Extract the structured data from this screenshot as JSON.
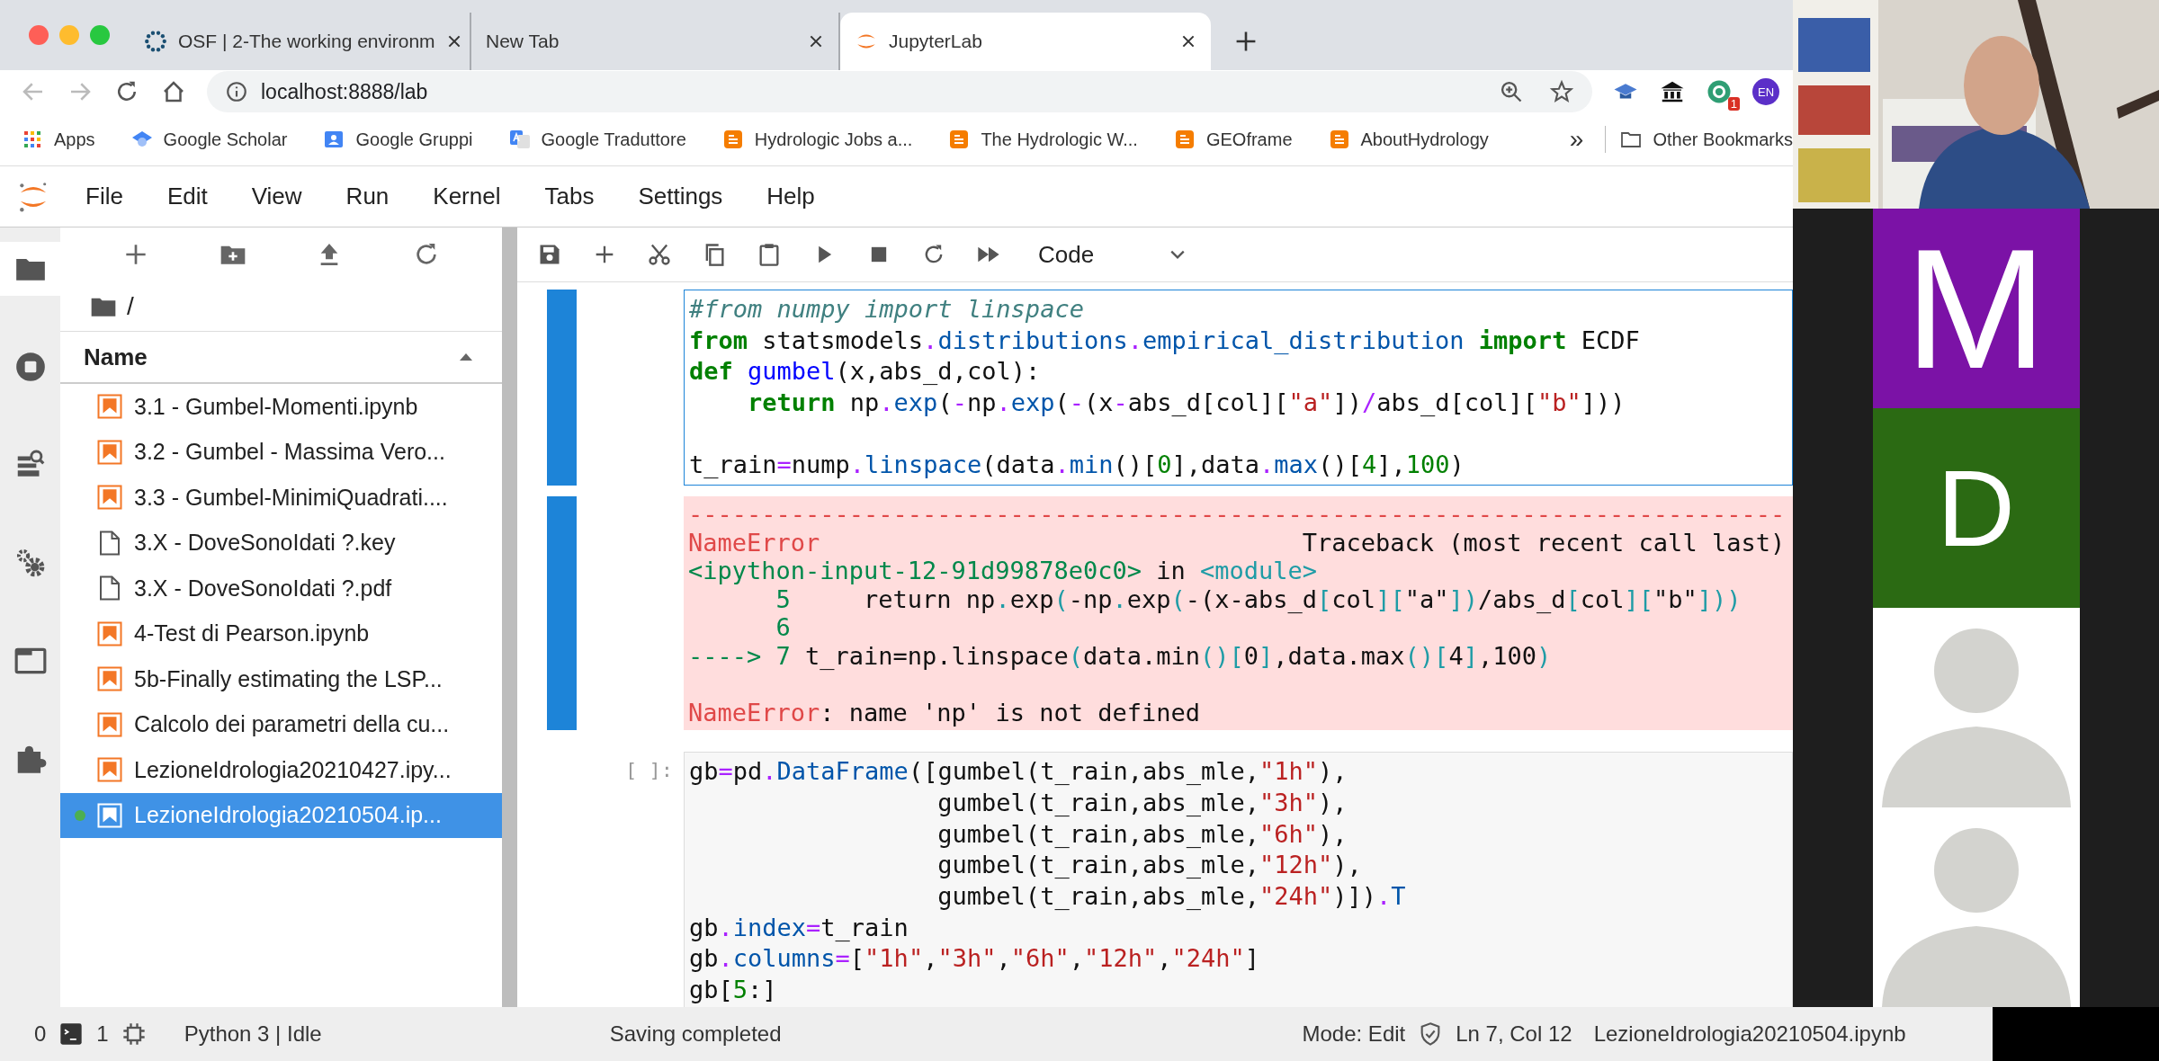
{
  "browser": {
    "tabs": [
      {
        "title": "OSF | 2-The working environm",
        "kind": "osf",
        "selected": false
      },
      {
        "title": "New Tab",
        "kind": "blank",
        "selected": false
      },
      {
        "title": "JupyterLab",
        "kind": "jupyter",
        "selected": true
      }
    ],
    "address": "localhost:8888/lab",
    "extension_badge": "1",
    "profile": "EN",
    "bookmarks": [
      {
        "label": "Apps",
        "kind": "apps"
      },
      {
        "label": "Google Scholar",
        "kind": "scholar"
      },
      {
        "label": "Google Gruppi",
        "kind": "groups"
      },
      {
        "label": "Google Traduttore",
        "kind": "translate"
      },
      {
        "label": "Hydrologic Jobs a...",
        "kind": "blog"
      },
      {
        "label": "The Hydrologic W...",
        "kind": "blog"
      },
      {
        "label": "GEOframe",
        "kind": "blog"
      },
      {
        "label": "AboutHydrology",
        "kind": "blog"
      }
    ],
    "more": "»",
    "other_bookmarks": "Other Bookmarks"
  },
  "jupyter": {
    "menu": [
      "File",
      "Edit",
      "View",
      "Run",
      "Kernel",
      "Tabs",
      "Settings",
      "Help"
    ],
    "file_browser": {
      "path": "/",
      "header": "Name",
      "files": [
        {
          "name": "3.1 - Gumbel-Momenti.ipynb",
          "kind": "notebook",
          "selected": false,
          "running": false
        },
        {
          "name": "3.2 - Gumbel - Massima Vero...",
          "kind": "notebook",
          "selected": false,
          "running": false
        },
        {
          "name": "3.3 - Gumbel-MinimiQuadrati....",
          "kind": "notebook",
          "selected": false,
          "running": false
        },
        {
          "name": "3.X - DoveSonoIdati ?.key",
          "kind": "file",
          "selected": false,
          "running": false
        },
        {
          "name": "3.X - DoveSonoIdati ?.pdf",
          "kind": "file",
          "selected": false,
          "running": false
        },
        {
          "name": "4-Test di Pearson.ipynb",
          "kind": "notebook",
          "selected": false,
          "running": false
        },
        {
          "name": "5b-Finally estimating the LSP...",
          "kind": "notebook",
          "selected": false,
          "running": false
        },
        {
          "name": "Calcolo dei parametri della cu...",
          "kind": "notebook",
          "selected": false,
          "running": false
        },
        {
          "name": "LezioneIdrologia20210427.ipy...",
          "kind": "notebook",
          "selected": false,
          "running": false
        },
        {
          "name": "LezioneIdrologia20210504.ip...",
          "kind": "notebook",
          "selected": true,
          "running": true
        }
      ]
    },
    "cell_type": "Code",
    "cells": [
      {
        "selected": true,
        "editing": true,
        "input": [
          {
            "kind": "code",
            "tokens": [
              {
                "text": "#from numpy import linspace",
                "kind": "c"
              }
            ]
          },
          {
            "kind": "code",
            "tokens": [
              {
                "text": "from",
                "kind": "k"
              },
              {
                "text": " statsmodels",
                "kind": "p"
              },
              {
                "text": ".",
                "kind": "o"
              },
              {
                "text": "distributions",
                "kind": "a"
              },
              {
                "text": ".",
                "kind": "o"
              },
              {
                "text": "empirical_distribution",
                "kind": "a"
              },
              {
                "text": " import",
                "kind": "k"
              },
              {
                "text": " ECDF",
                "kind": "p"
              }
            ]
          },
          {
            "kind": "code",
            "tokens": [
              {
                "text": "def",
                "kind": "k"
              },
              {
                "text": " gumbel",
                "kind": "d"
              },
              {
                "text": "(x,abs_d,col):",
                "kind": "p"
              }
            ]
          },
          {
            "kind": "code",
            "tokens": [
              {
                "text": "    return",
                "kind": "k"
              },
              {
                "text": " np",
                "kind": "p"
              },
              {
                "text": ".",
                "kind": "o"
              },
              {
                "text": "exp",
                "kind": "a"
              },
              {
                "text": "(",
                "kind": "p"
              },
              {
                "text": "-",
                "kind": "o"
              },
              {
                "text": "np",
                "kind": "p"
              },
              {
                "text": ".",
                "kind": "o"
              },
              {
                "text": "exp",
                "kind": "a"
              },
              {
                "text": "(",
                "kind": "p"
              },
              {
                "text": "-",
                "kind": "o"
              },
              {
                "text": "(x",
                "kind": "p"
              },
              {
                "text": "-",
                "kind": "o"
              },
              {
                "text": "abs_d[col][",
                "kind": "p"
              },
              {
                "text": "\"a\"",
                "kind": "s"
              },
              {
                "text": "])",
                "kind": "p"
              },
              {
                "text": "/",
                "kind": "o"
              },
              {
                "text": "abs_d[col][",
                "kind": "p"
              },
              {
                "text": "\"b\"",
                "kind": "s"
              },
              {
                "text": "]))",
                "kind": "p"
              }
            ]
          },
          {
            "kind": "blank"
          },
          {
            "kind": "code",
            "tokens": [
              {
                "text": "t_rain",
                "kind": "p"
              },
              {
                "text": "=",
                "kind": "o"
              },
              {
                "text": "nump",
                "kind": "p"
              },
              {
                "text": ".",
                "kind": "o"
              },
              {
                "text": "linspace",
                "kind": "a"
              },
              {
                "text": "(data",
                "kind": "p"
              },
              {
                "text": ".",
                "kind": "o"
              },
              {
                "text": "min",
                "kind": "a"
              },
              {
                "text": "()[",
                "kind": "p"
              },
              {
                "text": "0",
                "kind": "n"
              },
              {
                "text": "],data",
                "kind": "p"
              },
              {
                "text": ".",
                "kind": "o"
              },
              {
                "text": "max",
                "kind": "a"
              },
              {
                "text": "()[",
                "kind": "p"
              },
              {
                "text": "4",
                "kind": "n"
              },
              {
                "text": "],",
                "kind": "p"
              },
              {
                "text": "100",
                "kind": "n"
              },
              {
                "text": ")",
                "kind": "p"
              }
            ]
          }
        ],
        "output": [
          {
            "kind": "code",
            "tokens": [
              {
                "text": "---------------------------------------------------------------------------",
                "kind": "er"
              }
            ]
          },
          {
            "kind": "code",
            "tokens": [
              {
                "text": "NameError",
                "kind": "er"
              },
              {
                "text": "                                 Traceback (most recent call last)",
                "kind": "p"
              }
            ]
          },
          {
            "kind": "code",
            "tokens": [
              {
                "text": "<ipython-input-12-91d99878e0c0>",
                "kind": "eg"
              },
              {
                "text": " in ",
                "kind": "p"
              },
              {
                "text": "<module>",
                "kind": "ec"
              }
            ]
          },
          {
            "kind": "code",
            "tokens": [
              {
                "text": "      5",
                "kind": "eg"
              },
              {
                "text": "     return np",
                "kind": "p"
              },
              {
                "text": ".",
                "kind": "ec"
              },
              {
                "text": "exp",
                "kind": "p"
              },
              {
                "text": "(",
                "kind": "ec"
              },
              {
                "text": "-np",
                "kind": "p"
              },
              {
                "text": ".",
                "kind": "ec"
              },
              {
                "text": "exp",
                "kind": "p"
              },
              {
                "text": "(",
                "kind": "ec"
              },
              {
                "text": "-(x-abs_d",
                "kind": "p"
              },
              {
                "text": "[",
                "kind": "ec"
              },
              {
                "text": "col",
                "kind": "p"
              },
              {
                "text": "][",
                "kind": "ec"
              },
              {
                "text": "\"a\"",
                "kind": "p"
              },
              {
                "text": "])",
                "kind": "ec"
              },
              {
                "text": "/abs_d",
                "kind": "p"
              },
              {
                "text": "[",
                "kind": "ec"
              },
              {
                "text": "col",
                "kind": "p"
              },
              {
                "text": "][",
                "kind": "ec"
              },
              {
                "text": "\"b\"",
                "kind": "p"
              },
              {
                "text": "]))",
                "kind": "ec"
              }
            ]
          },
          {
            "kind": "code",
            "tokens": [
              {
                "text": "      6",
                "kind": "eg"
              }
            ]
          },
          {
            "kind": "code",
            "tokens": [
              {
                "text": "----> 7",
                "kind": "eg"
              },
              {
                "text": " t_rain=np.linspace",
                "kind": "p"
              },
              {
                "text": "(",
                "kind": "ec"
              },
              {
                "text": "data.min",
                "kind": "p"
              },
              {
                "text": "()[",
                "kind": "ec"
              },
              {
                "text": "0",
                "kind": "p"
              },
              {
                "text": "]",
                "kind": "ec"
              },
              {
                "text": ",data.max",
                "kind": "p"
              },
              {
                "text": "()[",
                "kind": "ec"
              },
              {
                "text": "4",
                "kind": "p"
              },
              {
                "text": "]",
                "kind": "ec"
              },
              {
                "text": ",100",
                "kind": "p"
              },
              {
                "text": ")",
                "kind": "ec"
              }
            ]
          },
          {
            "kind": "blank"
          },
          {
            "kind": "code",
            "tokens": [
              {
                "text": "NameError",
                "kind": "er"
              },
              {
                "text": ": name 'np' is not defined",
                "kind": "p"
              }
            ]
          }
        ]
      },
      {
        "selected": false,
        "editing": false,
        "prompt": "[ ]:",
        "input": [
          {
            "kind": "code",
            "tokens": [
              {
                "text": "gb",
                "kind": "p"
              },
              {
                "text": "=",
                "kind": "o"
              },
              {
                "text": "pd",
                "kind": "p"
              },
              {
                "text": ".",
                "kind": "o"
              },
              {
                "text": "DataFrame",
                "kind": "a"
              },
              {
                "text": "([gumbel(t_rain,abs_mle,",
                "kind": "p"
              },
              {
                "text": "\"1h\"",
                "kind": "s"
              },
              {
                "text": "),",
                "kind": "p"
              }
            ]
          },
          {
            "kind": "code",
            "tokens": [
              {
                "text": "                 gumbel(t_rain,abs_mle,",
                "kind": "p"
              },
              {
                "text": "\"3h\"",
                "kind": "s"
              },
              {
                "text": "),",
                "kind": "p"
              }
            ]
          },
          {
            "kind": "code",
            "tokens": [
              {
                "text": "                 gumbel(t_rain,abs_mle,",
                "kind": "p"
              },
              {
                "text": "\"6h\"",
                "kind": "s"
              },
              {
                "text": "),",
                "kind": "p"
              }
            ]
          },
          {
            "kind": "code",
            "tokens": [
              {
                "text": "                 gumbel(t_rain,abs_mle,",
                "kind": "p"
              },
              {
                "text": "\"12h\"",
                "kind": "s"
              },
              {
                "text": "),",
                "kind": "p"
              }
            ]
          },
          {
            "kind": "code",
            "tokens": [
              {
                "text": "                 gumbel(t_rain,abs_mle,",
                "kind": "p"
              },
              {
                "text": "\"24h\"",
                "kind": "s"
              },
              {
                "text": ")])",
                "kind": "p"
              },
              {
                "text": ".",
                "kind": "o"
              },
              {
                "text": "T",
                "kind": "a"
              }
            ]
          },
          {
            "kind": "code",
            "tokens": [
              {
                "text": "gb",
                "kind": "p"
              },
              {
                "text": ".",
                "kind": "o"
              },
              {
                "text": "index",
                "kind": "a"
              },
              {
                "text": "=",
                "kind": "o"
              },
              {
                "text": "t_rain",
                "kind": "p"
              }
            ]
          },
          {
            "kind": "code",
            "tokens": [
              {
                "text": "gb",
                "kind": "p"
              },
              {
                "text": ".",
                "kind": "o"
              },
              {
                "text": "columns",
                "kind": "a"
              },
              {
                "text": "=",
                "kind": "o"
              },
              {
                "text": "[",
                "kind": "p"
              },
              {
                "text": "\"1h\"",
                "kind": "s"
              },
              {
                "text": ",",
                "kind": "p"
              },
              {
                "text": "\"3h\"",
                "kind": "s"
              },
              {
                "text": ",",
                "kind": "p"
              },
              {
                "text": "\"6h\"",
                "kind": "s"
              },
              {
                "text": ",",
                "kind": "p"
              },
              {
                "text": "\"12h\"",
                "kind": "s"
              },
              {
                "text": ",",
                "kind": "p"
              },
              {
                "text": "\"24h\"",
                "kind": "s"
              },
              {
                "text": "]",
                "kind": "p"
              }
            ]
          },
          {
            "kind": "code",
            "tokens": [
              {
                "text": "gb[",
                "kind": "p"
              },
              {
                "text": "5",
                "kind": "n"
              },
              {
                "text": ":]",
                "kind": "p"
              }
            ]
          }
        ]
      }
    ],
    "status_bar": {
      "terminals": "0",
      "kernels": "1",
      "kernel": "Python 3 | Idle",
      "message": "Saving completed",
      "mode": "Mode: Edit",
      "cursor": "Ln 7, Col 12",
      "file": "LezioneIdrologia20210504.ipynb"
    }
  },
  "call": {
    "participants": [
      {
        "kind": "camera"
      },
      {
        "kind": "initial",
        "initial": "M",
        "color": "#7b12a6"
      },
      {
        "kind": "initial",
        "initial": "D",
        "color": "#2b6a13"
      },
      {
        "kind": "avatar"
      },
      {
        "kind": "avatar"
      }
    ]
  }
}
